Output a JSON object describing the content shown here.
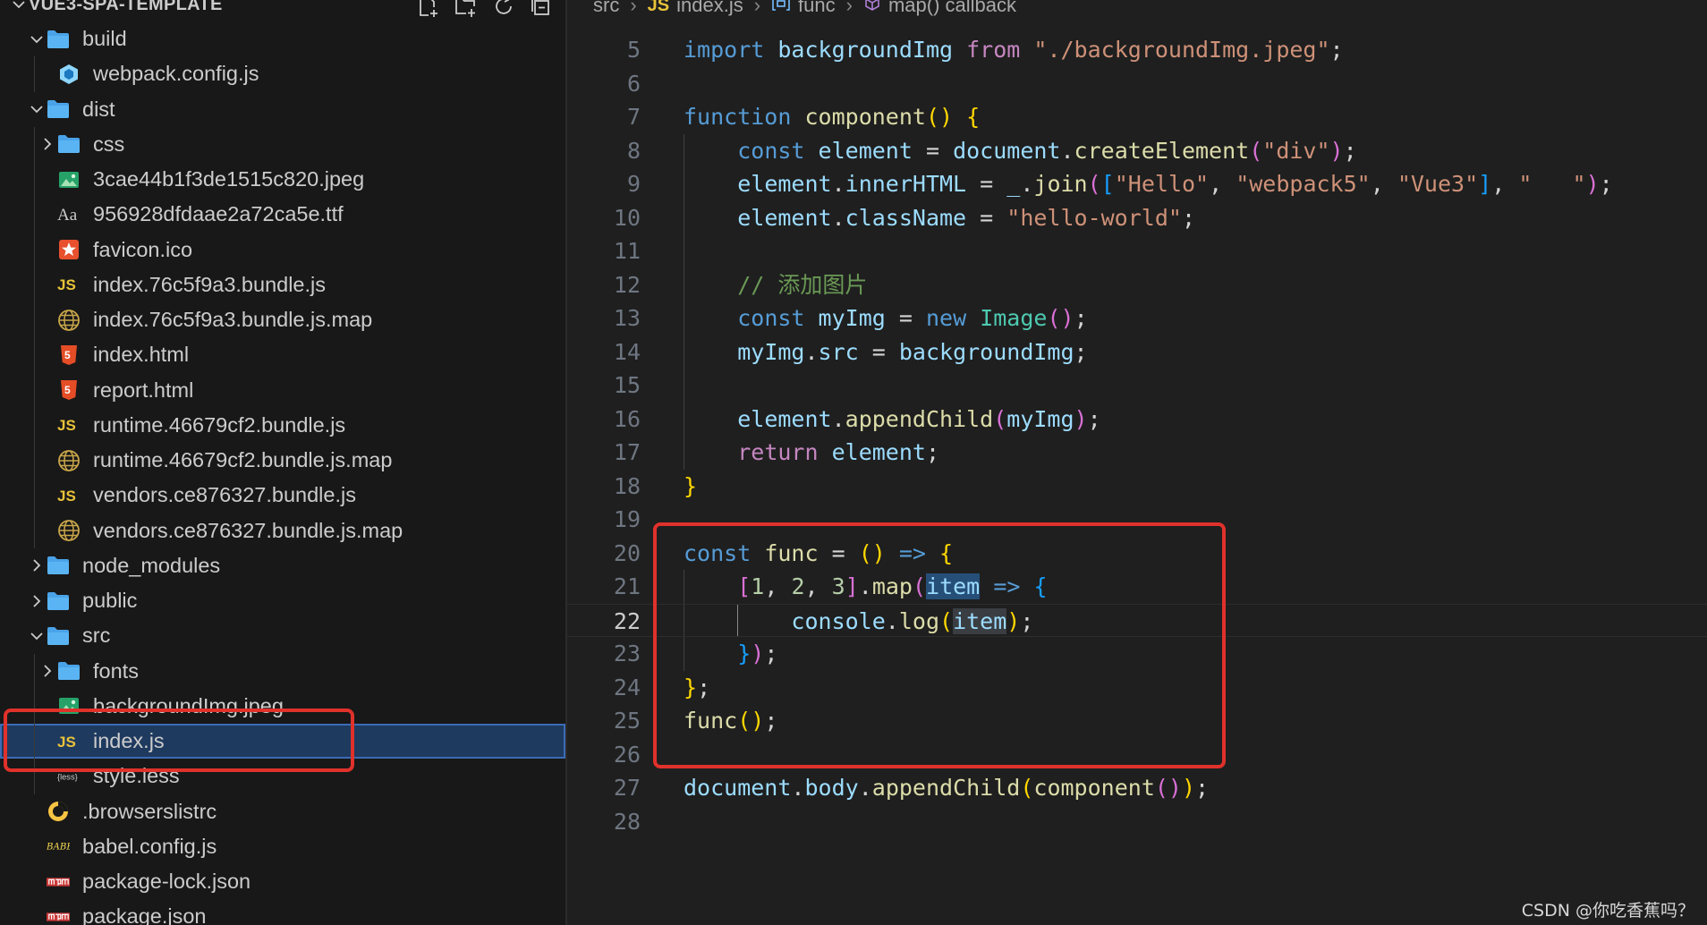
{
  "explorer": {
    "title": "VUE3-SPA-TEMPLATE",
    "items": [
      {
        "label": "build",
        "kind": "folder",
        "depth": 0,
        "open": true
      },
      {
        "label": "webpack.config.js",
        "kind": "webpack",
        "depth": 1
      },
      {
        "label": "dist",
        "kind": "folder",
        "depth": 0,
        "open": true
      },
      {
        "label": "css",
        "kind": "folder",
        "depth": 1,
        "open": false
      },
      {
        "label": "3cae44b1f3de1515c820.jpeg",
        "kind": "image",
        "depth": 1
      },
      {
        "label": "956928dfdaae2a72ca5e.ttf",
        "kind": "font",
        "depth": 1
      },
      {
        "label": "favicon.ico",
        "kind": "favicon",
        "depth": 1
      },
      {
        "label": "index.76c5f9a3.bundle.js",
        "kind": "js",
        "depth": 1
      },
      {
        "label": "index.76c5f9a3.bundle.js.map",
        "kind": "map",
        "depth": 1
      },
      {
        "label": "index.html",
        "kind": "html",
        "depth": 1
      },
      {
        "label": "report.html",
        "kind": "html",
        "depth": 1
      },
      {
        "label": "runtime.46679cf2.bundle.js",
        "kind": "js",
        "depth": 1
      },
      {
        "label": "runtime.46679cf2.bundle.js.map",
        "kind": "map",
        "depth": 1
      },
      {
        "label": "vendors.ce876327.bundle.js",
        "kind": "js",
        "depth": 1
      },
      {
        "label": "vendors.ce876327.bundle.js.map",
        "kind": "map",
        "depth": 1
      },
      {
        "label": "node_modules",
        "kind": "folder",
        "depth": 0,
        "open": false
      },
      {
        "label": "public",
        "kind": "folder",
        "depth": 0,
        "open": false
      },
      {
        "label": "src",
        "kind": "folder",
        "depth": 0,
        "open": true
      },
      {
        "label": "fonts",
        "kind": "folder",
        "depth": 1,
        "open": false
      },
      {
        "label": "backgroundImg.jpeg",
        "kind": "image",
        "depth": 1
      },
      {
        "label": "index.js",
        "kind": "js",
        "depth": 1,
        "selected": true
      },
      {
        "label": "style.less",
        "kind": "less",
        "depth": 1
      },
      {
        "label": ".browserslistrc",
        "kind": "browserslist",
        "depth": 0
      },
      {
        "label": "babel.config.js",
        "kind": "babel",
        "depth": 0
      },
      {
        "label": "package-lock.json",
        "kind": "npm",
        "depth": 0
      },
      {
        "label": "package.json",
        "kind": "npm",
        "depth": 0
      }
    ]
  },
  "breadcrumb": {
    "src": "src",
    "js_badge": "JS",
    "file": "index.js",
    "func": "func",
    "callback": "map() callback"
  },
  "editor": {
    "current_line": 22,
    "lines": [
      {
        "n": "5",
        "depth": 0,
        "tokens": [
          [
            "kw",
            "import"
          ],
          [
            "op",
            " "
          ],
          [
            "var",
            "backgroundImg"
          ],
          [
            "op",
            " "
          ],
          [
            "ctl",
            "from"
          ],
          [
            "op",
            " "
          ],
          [
            "str",
            "\"./backgroundImg.jpeg\""
          ],
          [
            "op",
            ";"
          ]
        ]
      },
      {
        "n": "6",
        "depth": 0,
        "tokens": []
      },
      {
        "n": "7",
        "depth": 0,
        "tokens": [
          [
            "kw",
            "function"
          ],
          [
            "op",
            " "
          ],
          [
            "fn",
            "component"
          ],
          [
            "b1",
            "()"
          ],
          [
            "op",
            " "
          ],
          [
            "b1",
            "{"
          ]
        ]
      },
      {
        "n": "8",
        "depth": 1,
        "tokens": [
          [
            "op",
            "    "
          ],
          [
            "kw",
            "const"
          ],
          [
            "op",
            " "
          ],
          [
            "var",
            "element"
          ],
          [
            "op",
            " = "
          ],
          [
            "var",
            "document"
          ],
          [
            "op",
            "."
          ],
          [
            "fn",
            "createElement"
          ],
          [
            "b2",
            "("
          ],
          [
            "str",
            "\"div\""
          ],
          [
            "b2",
            ")"
          ],
          [
            "op",
            ";"
          ]
        ]
      },
      {
        "n": "9",
        "depth": 1,
        "tokens": [
          [
            "op",
            "    "
          ],
          [
            "var",
            "element"
          ],
          [
            "op",
            "."
          ],
          [
            "var",
            "innerHTML"
          ],
          [
            "op",
            " = "
          ],
          [
            "var",
            "_"
          ],
          [
            "op",
            "."
          ],
          [
            "fn",
            "join"
          ],
          [
            "b2",
            "("
          ],
          [
            "b3",
            "["
          ],
          [
            "str",
            "\"Hello\""
          ],
          [
            "op",
            ", "
          ],
          [
            "str",
            "\"webpack5\""
          ],
          [
            "op",
            ", "
          ],
          [
            "str",
            "\"Vue3\""
          ],
          [
            "b3",
            "]"
          ],
          [
            "op",
            ", "
          ],
          [
            "str",
            "\"   \""
          ],
          [
            "b2",
            ")"
          ],
          [
            "op",
            ";"
          ]
        ]
      },
      {
        "n": "10",
        "depth": 1,
        "tokens": [
          [
            "op",
            "    "
          ],
          [
            "var",
            "element"
          ],
          [
            "op",
            "."
          ],
          [
            "var",
            "className"
          ],
          [
            "op",
            " = "
          ],
          [
            "str",
            "\"hello-world\""
          ],
          [
            "op",
            ";"
          ]
        ]
      },
      {
        "n": "11",
        "depth": 1,
        "tokens": []
      },
      {
        "n": "12",
        "depth": 1,
        "tokens": [
          [
            "op",
            "    "
          ],
          [
            "com",
            "// 添加图片"
          ]
        ]
      },
      {
        "n": "13",
        "depth": 1,
        "tokens": [
          [
            "op",
            "    "
          ],
          [
            "kw",
            "const"
          ],
          [
            "op",
            " "
          ],
          [
            "var",
            "myImg"
          ],
          [
            "op",
            " = "
          ],
          [
            "kw",
            "new"
          ],
          [
            "op",
            " "
          ],
          [
            "cls",
            "Image"
          ],
          [
            "b2",
            "()"
          ],
          [
            "op",
            ";"
          ]
        ]
      },
      {
        "n": "14",
        "depth": 1,
        "tokens": [
          [
            "op",
            "    "
          ],
          [
            "var",
            "myImg"
          ],
          [
            "op",
            "."
          ],
          [
            "var",
            "src"
          ],
          [
            "op",
            " = "
          ],
          [
            "var",
            "backgroundImg"
          ],
          [
            "op",
            ";"
          ]
        ]
      },
      {
        "n": "15",
        "depth": 1,
        "tokens": []
      },
      {
        "n": "16",
        "depth": 1,
        "tokens": [
          [
            "op",
            "    "
          ],
          [
            "var",
            "element"
          ],
          [
            "op",
            "."
          ],
          [
            "fn",
            "appendChild"
          ],
          [
            "b2",
            "("
          ],
          [
            "var",
            "myImg"
          ],
          [
            "b2",
            ")"
          ],
          [
            "op",
            ";"
          ]
        ]
      },
      {
        "n": "17",
        "depth": 1,
        "tokens": [
          [
            "op",
            "    "
          ],
          [
            "ctl",
            "return"
          ],
          [
            "op",
            " "
          ],
          [
            "var",
            "element"
          ],
          [
            "op",
            ";"
          ]
        ]
      },
      {
        "n": "18",
        "depth": 0,
        "tokens": [
          [
            "b1",
            "}"
          ]
        ]
      },
      {
        "n": "19",
        "depth": 0,
        "tokens": []
      },
      {
        "n": "20",
        "depth": 0,
        "tokens": [
          [
            "kw",
            "const"
          ],
          [
            "op",
            " "
          ],
          [
            "fn",
            "func"
          ],
          [
            "op",
            " = "
          ],
          [
            "b1",
            "()"
          ],
          [
            "op",
            " "
          ],
          [
            "kw",
            "=>"
          ],
          [
            "op",
            " "
          ],
          [
            "b1",
            "{"
          ]
        ]
      },
      {
        "n": "21",
        "depth": 1,
        "tokens": [
          [
            "op",
            "    "
          ],
          [
            "b2",
            "["
          ],
          [
            "num",
            "1"
          ],
          [
            "op",
            ", "
          ],
          [
            "num",
            "2"
          ],
          [
            "op",
            ", "
          ],
          [
            "num",
            "3"
          ],
          [
            "b2",
            "]"
          ],
          [
            "op",
            "."
          ],
          [
            "fn",
            "map"
          ],
          [
            "b2",
            "("
          ],
          [
            "hl",
            "item"
          ],
          [
            "op",
            " "
          ],
          [
            "kw",
            "=>"
          ],
          [
            "op",
            " "
          ],
          [
            "b3",
            "{"
          ]
        ]
      },
      {
        "n": "22",
        "depth": 2,
        "tokens": [
          [
            "op",
            "        "
          ],
          [
            "var",
            "console"
          ],
          [
            "op",
            "."
          ],
          [
            "fn",
            "log"
          ],
          [
            "b1",
            "("
          ],
          [
            "hl2",
            "item"
          ],
          [
            "b1",
            ")"
          ],
          [
            "op",
            ";"
          ]
        ]
      },
      {
        "n": "23",
        "depth": 1,
        "tokens": [
          [
            "op",
            "    "
          ],
          [
            "b3",
            "}"
          ],
          [
            "b2",
            ")"
          ],
          [
            "op",
            ";"
          ]
        ]
      },
      {
        "n": "24",
        "depth": 0,
        "tokens": [
          [
            "b1",
            "}"
          ],
          [
            "op",
            ";"
          ]
        ]
      },
      {
        "n": "25",
        "depth": 0,
        "tokens": [
          [
            "fn",
            "func"
          ],
          [
            "b1",
            "()"
          ],
          [
            "op",
            ";"
          ]
        ]
      },
      {
        "n": "26",
        "depth": 0,
        "tokens": []
      },
      {
        "n": "27",
        "depth": 0,
        "tokens": [
          [
            "var",
            "document"
          ],
          [
            "op",
            "."
          ],
          [
            "var",
            "body"
          ],
          [
            "op",
            "."
          ],
          [
            "fn",
            "appendChild"
          ],
          [
            "b1",
            "("
          ],
          [
            "fn",
            "component"
          ],
          [
            "b2",
            "()"
          ],
          [
            "b1",
            ")"
          ],
          [
            "op",
            ";"
          ]
        ]
      },
      {
        "n": "28",
        "depth": 0,
        "tokens": []
      }
    ]
  },
  "watermark": "CSDN @你吃香蕉吗？",
  "colors": {
    "sidebar_bg": "#181818",
    "editor_bg": "#1f1f1f",
    "selection_bg": "#1f3a5f",
    "annotation_red": "#e0312b",
    "folder_blue": "#4aa3e8"
  }
}
